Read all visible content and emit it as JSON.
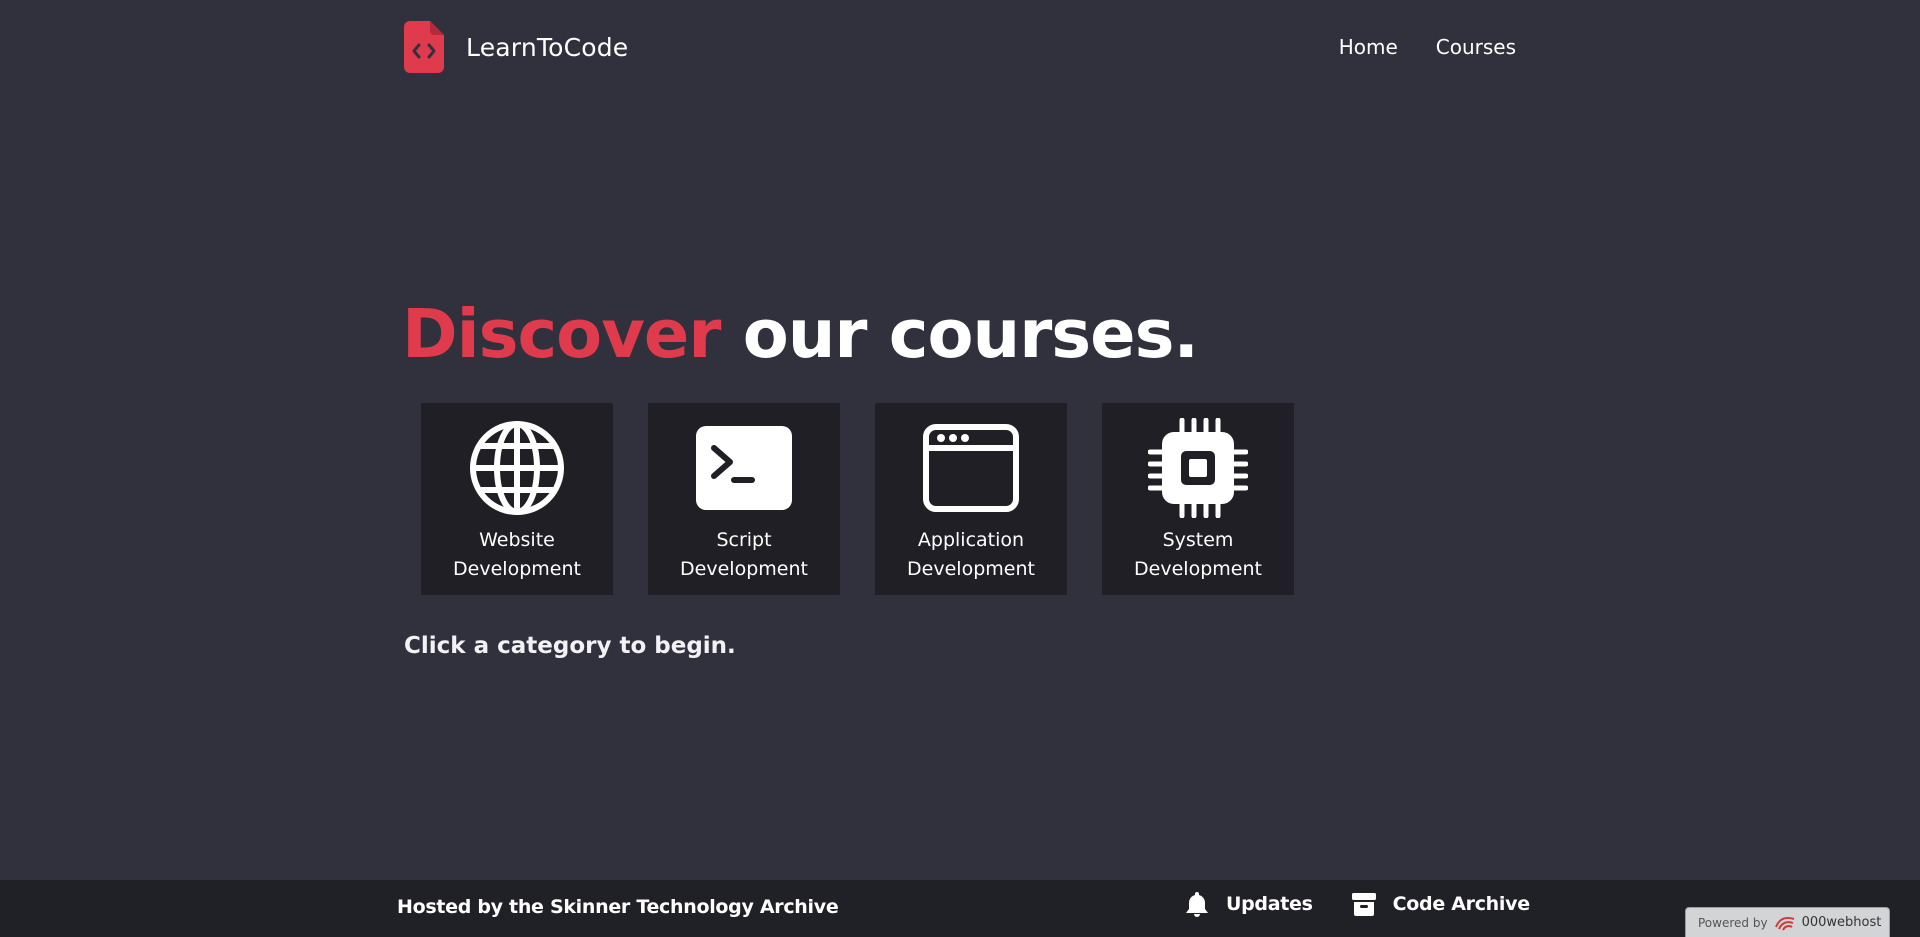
{
  "header": {
    "brand_name": "LearnToCode",
    "brand_icon": "code-file-icon",
    "nav": [
      {
        "label": "Home"
      },
      {
        "label": "Courses"
      }
    ]
  },
  "hero": {
    "accent": "Discover",
    "rest": "our courses."
  },
  "cards": [
    {
      "label": "Website\nDevelopment",
      "icon": "globe-icon"
    },
    {
      "label": "Script\nDevelopment",
      "icon": "terminal-icon"
    },
    {
      "label": "Application\nDevelopment",
      "icon": "app-window-icon"
    },
    {
      "label": "System\nDevelopment",
      "icon": "cpu-chip-icon"
    }
  ],
  "hint": "Click a category to begin.",
  "footer": {
    "host": "Hosted by the Skinner Technology Archive",
    "updates": "Updates",
    "archive": "Code Archive"
  },
  "powered": {
    "pre": "Powered by",
    "name": "000webhost"
  },
  "colors": {
    "background": "#31313d",
    "accent": "#e03b4d",
    "card": "#1f1f25",
    "footer": "#202027"
  }
}
